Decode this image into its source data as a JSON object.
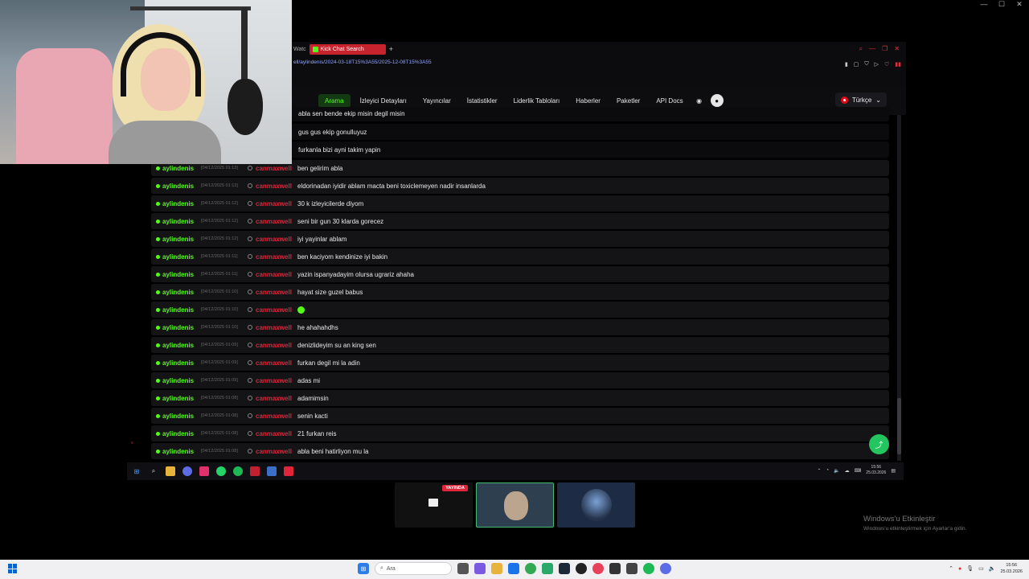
{
  "outer_window": {
    "controls": [
      "—",
      "☐",
      "✕"
    ]
  },
  "browser": {
    "tab_prefix": "Watc",
    "tab_title": "Kick Chat Search",
    "new_tab": "+",
    "url": "ell/aylindenis/2024-03-18T15%3A55/2025-12-08T15%3A55"
  },
  "nav": {
    "items": [
      "Arama",
      "İzleyici Detayları",
      "Yayıncılar",
      "İstatistikler",
      "Liderlik Tabloları",
      "Haberler",
      "Paketler",
      "API Docs"
    ],
    "active": "Arama",
    "language": "Türkçe"
  },
  "chat": {
    "partial_rows": [
      {
        "message": "abla sen bende ekip misin degil misin"
      },
      {
        "message": "gus gus ekip gonulluyuz"
      },
      {
        "message": "furkanla bizi ayni takim yapin"
      }
    ],
    "rows": [
      {
        "user": "aylindenis",
        "time": "[04/12/2025 01:13]",
        "target": "canmaxwell",
        "message": "ben gelirim abla"
      },
      {
        "user": "aylindenis",
        "time": "[04/12/2025 01:13]",
        "target": "canmaxwell",
        "message": "eldorinadan iyidir ablam macta beni toxiclemeyen nadir insanlarda"
      },
      {
        "user": "aylindenis",
        "time": "[04/12/2025 01:12]",
        "target": "canmaxwell",
        "message": "30 k izleyicilerde diyom"
      },
      {
        "user": "aylindenis",
        "time": "[04/12/2025 01:12]",
        "target": "canmaxwell",
        "message": "seni bir gun 30 klarda gorecez"
      },
      {
        "user": "aylindenis",
        "time": "[04/12/2025 01:12]",
        "target": "canmaxwell",
        "message": "iyi yayinlar ablam"
      },
      {
        "user": "aylindenis",
        "time": "[04/12/2025 01:11]",
        "target": "canmaxwell",
        "message": "ben kaciyom kendinize iyi bakin"
      },
      {
        "user": "aylindenis",
        "time": "[04/12/2025 01:11]",
        "target": "canmaxwell",
        "message": "yazin ispanyadayim olursa ugrariz ahaha"
      },
      {
        "user": "aylindenis",
        "time": "[04/12/2025 01:10]",
        "target": "canmaxwell",
        "message": "hayat size guzel babus"
      },
      {
        "user": "aylindenis",
        "time": "[04/12/2025 01:10]",
        "target": "canmaxwell",
        "message": ""
      },
      {
        "user": "aylindenis",
        "time": "[04/12/2025 01:10]",
        "target": "canmaxwell",
        "message": "he ahahahdhs"
      },
      {
        "user": "aylindenis",
        "time": "[04/12/2025 01:09]",
        "target": "canmaxwell",
        "message": "denizlideyim su an king sen"
      },
      {
        "user": "aylindenis",
        "time": "[04/12/2025 01:09]",
        "target": "canmaxwell",
        "message": "furkan degil mi la adin"
      },
      {
        "user": "aylindenis",
        "time": "[04/12/2025 01:09]",
        "target": "canmaxwell",
        "message": "adas mi"
      },
      {
        "user": "aylindenis",
        "time": "[04/12/2025 01:08]",
        "target": "canmaxwell",
        "message": "adamimsin"
      },
      {
        "user": "aylindenis",
        "time": "[04/12/2025 01:08]",
        "target": "canmaxwell",
        "message": "senin kacti"
      },
      {
        "user": "aylindenis",
        "time": "[04/12/2025 01:08]",
        "target": "canmaxwell",
        "message": "21 furkan reis"
      },
      {
        "user": "aylindenis",
        "time": "[04/12/2025 01:08]",
        "target": "canmaxwell",
        "message": "abla beni hatirliyon mu la"
      }
    ]
  },
  "inner_taskbar": {
    "time": "15:56",
    "date": "25.03.2026"
  },
  "thumbnails": {
    "live_badge": "YAYINDA"
  },
  "activation": {
    "title": "Windows'u Etkinleştir",
    "subtitle": "Windows'u etkinleştirmek için Ayarlar'a gidin."
  },
  "taskbar": {
    "search_placeholder": "Ara",
    "time": "15:56",
    "date": "25.03.2026"
  },
  "colors": {
    "kick_green": "#53fc18",
    "accent_red": "#e0243a"
  }
}
